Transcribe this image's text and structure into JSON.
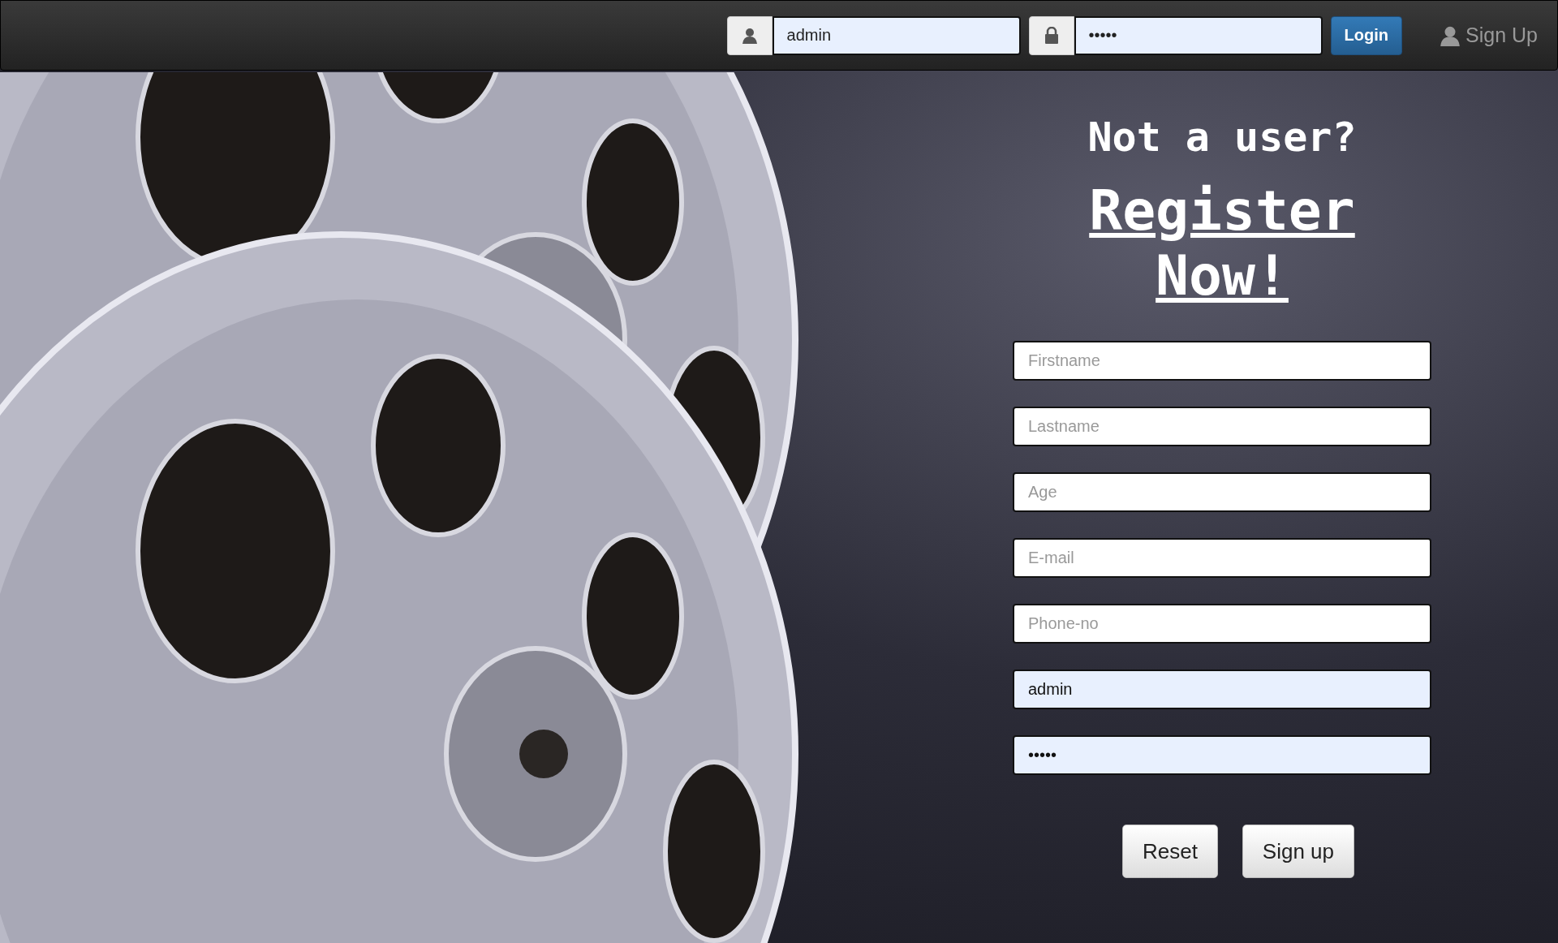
{
  "navbar": {
    "username": {
      "value": "admin"
    },
    "password": {
      "value": "•••••"
    },
    "login_button": "Login",
    "signup_link": "Sign Up"
  },
  "register": {
    "heading": "Not a user?",
    "link": "Register Now!",
    "fields": [
      {
        "placeholder": "Firstname"
      },
      {
        "placeholder": "Lastname"
      },
      {
        "placeholder": "Age"
      },
      {
        "placeholder": "E-mail"
      },
      {
        "placeholder": "Phone-no"
      },
      {
        "value": "admin"
      },
      {
        "value": "•••••"
      }
    ],
    "buttons": [
      "Reset",
      "Sign up"
    ]
  }
}
